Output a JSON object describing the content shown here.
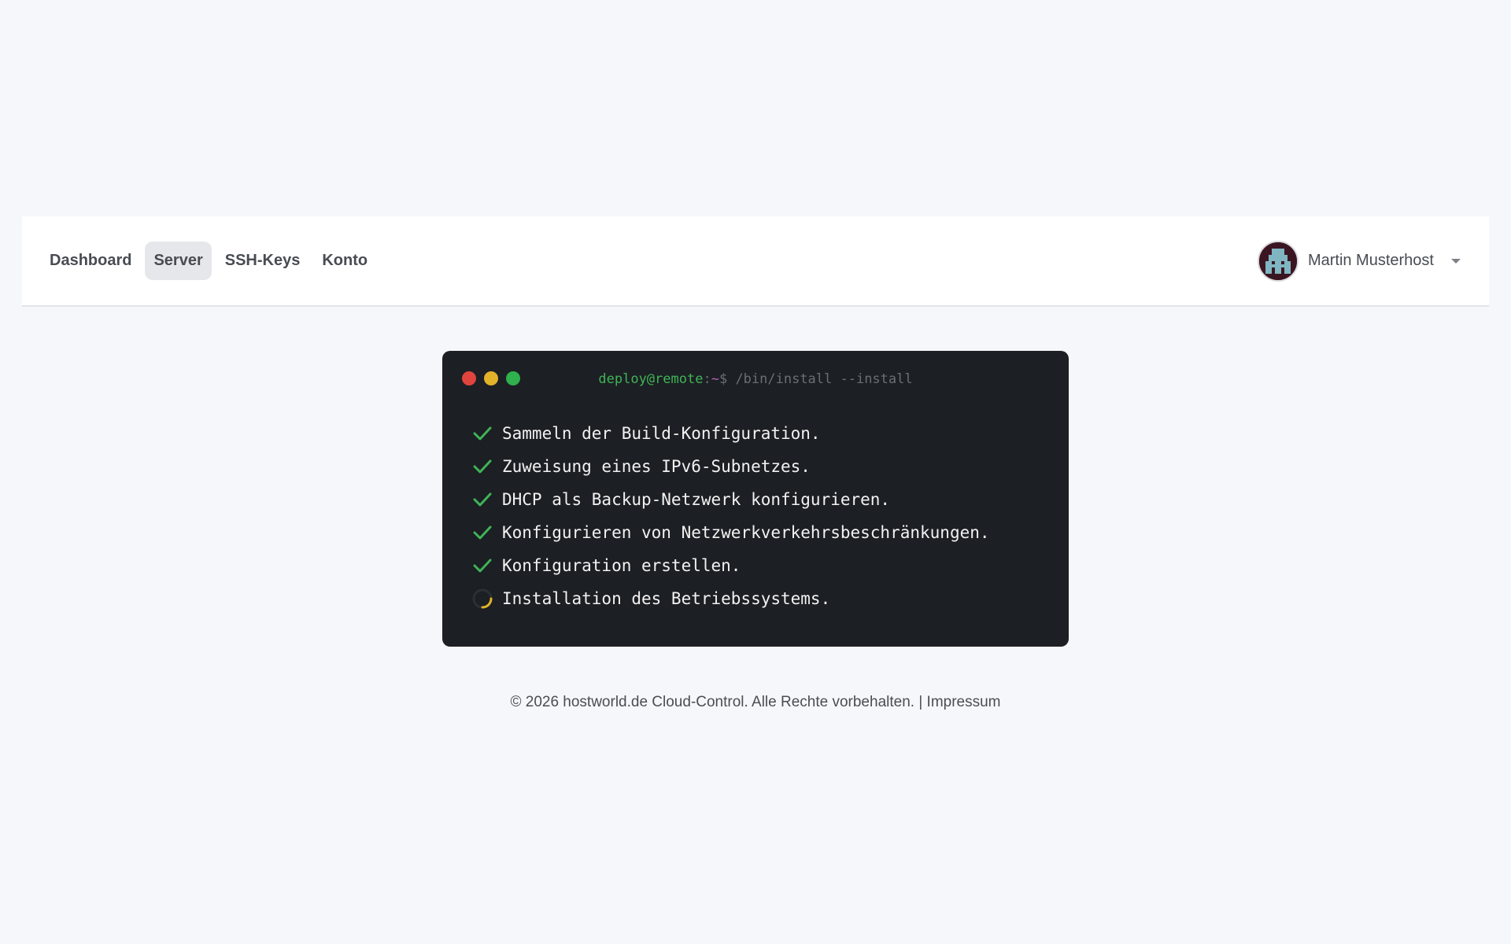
{
  "nav": {
    "links": [
      {
        "label": "Dashboard",
        "active": false
      },
      {
        "label": "Server",
        "active": true
      },
      {
        "label": "SSH-Keys",
        "active": false
      },
      {
        "label": "Konto",
        "active": false
      }
    ],
    "user": {
      "name": "Martin Musterhost",
      "avatar_icon": "pixel-avatar-icon"
    }
  },
  "terminal": {
    "prompt_user": "deploy@remote",
    "prompt_sep": ":",
    "prompt_path": "~",
    "prompt_symbol": "$",
    "command": " /bin/install --install",
    "steps": [
      {
        "text": "Sammeln der Build-Konfiguration.",
        "status": "done"
      },
      {
        "text": "Zuweisung eines IPv6-Subnetzes.",
        "status": "done"
      },
      {
        "text": "DHCP als Backup-Netzwerk konfigurieren.",
        "status": "done"
      },
      {
        "text": "Konfigurieren von Netzwerkverkehrsbeschränkungen.",
        "status": "done"
      },
      {
        "text": "Konfiguration erstellen.",
        "status": "done"
      },
      {
        "text": "Installation des Betriebssystems.",
        "status": "in-progress"
      }
    ],
    "colors": {
      "check": "#3fb457",
      "spinner": "#e2b22a",
      "red": "#e0443e",
      "yellow": "#e2b22a",
      "green": "#2fb14d"
    }
  },
  "footer": {
    "copyright": "© 2026 hostworld.de Cloud-Control. Alle Rechte vorbehalten.",
    "separator": " | ",
    "impressum": "Impressum"
  }
}
